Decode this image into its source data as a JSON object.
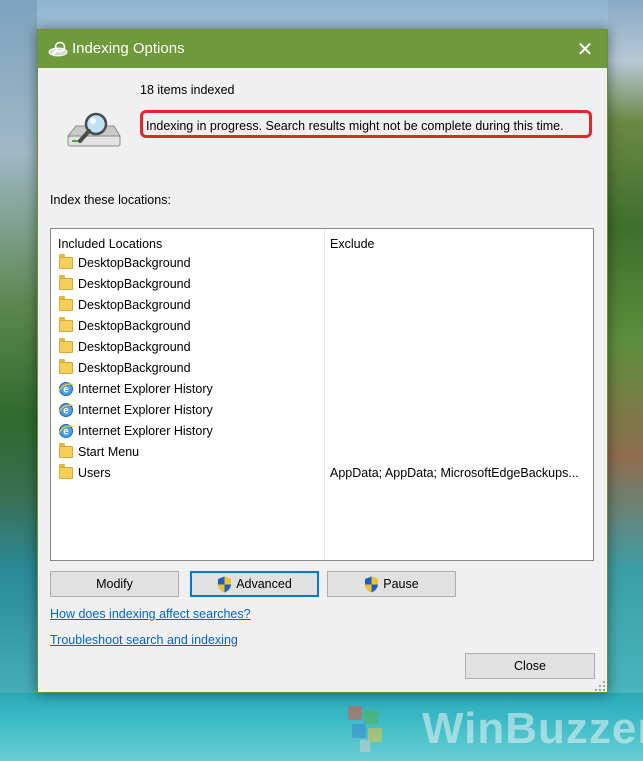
{
  "window": {
    "title": "Indexing Options",
    "close_glyph": "✕"
  },
  "status": {
    "items_indexed": "18 items indexed",
    "message": "Indexing in progress. Search results might not be complete during this time."
  },
  "locations": {
    "section_label": "Index these locations:",
    "headers": {
      "included": "Included Locations",
      "exclude": "Exclude"
    },
    "rows": [
      {
        "icon": "folder-icon",
        "location": "DesktopBackground",
        "exclude": ""
      },
      {
        "icon": "folder-icon",
        "location": "DesktopBackground",
        "exclude": ""
      },
      {
        "icon": "folder-icon",
        "location": "DesktopBackground",
        "exclude": ""
      },
      {
        "icon": "folder-icon",
        "location": "DesktopBackground",
        "exclude": ""
      },
      {
        "icon": "folder-icon",
        "location": "DesktopBackground",
        "exclude": ""
      },
      {
        "icon": "folder-icon",
        "location": "DesktopBackground",
        "exclude": ""
      },
      {
        "icon": "internet-explorer-icon",
        "location": "Internet Explorer History",
        "exclude": ""
      },
      {
        "icon": "internet-explorer-icon",
        "location": "Internet Explorer History",
        "exclude": ""
      },
      {
        "icon": "internet-explorer-icon",
        "location": "Internet Explorer History",
        "exclude": ""
      },
      {
        "icon": "folder-icon",
        "location": "Start Menu",
        "exclude": ""
      },
      {
        "icon": "folder-icon",
        "location": "Users",
        "exclude": "AppData; AppData; MicrosoftEdgeBackups..."
      }
    ]
  },
  "buttons": {
    "modify": "Modify",
    "advanced": "Advanced",
    "pause": "Pause",
    "close": "Close"
  },
  "links": {
    "how_indexing": "How does indexing affect searches?",
    "troubleshoot": "Troubleshoot search and indexing"
  },
  "watermark": {
    "text": "WinBuzzer"
  },
  "colors": {
    "titlebar": "#6f9a3b",
    "highlight_border": "#e6262b",
    "link": "#0066cc",
    "focus_border": "#0078d7"
  }
}
